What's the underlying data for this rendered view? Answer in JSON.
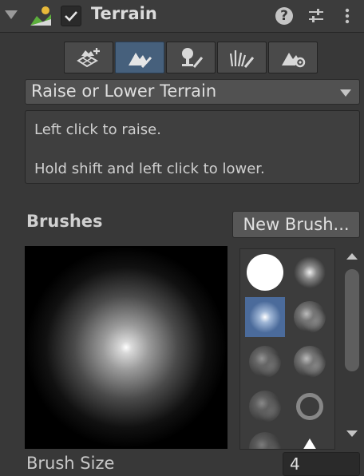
{
  "header": {
    "title": "Terrain",
    "enabled": true
  },
  "toolbar": {
    "tools": [
      {
        "icon": "create-neighbor-terrain-icon"
      },
      {
        "icon": "paint-terrain-icon",
        "active": true
      },
      {
        "icon": "paint-trees-icon"
      },
      {
        "icon": "paint-details-icon"
      },
      {
        "icon": "terrain-settings-icon"
      }
    ]
  },
  "tool_select": {
    "value": "Raise or Lower Terrain"
  },
  "help": {
    "line1": "Left click to raise.",
    "line2": "Hold shift and left click to lower."
  },
  "brushes": {
    "label": "Brushes",
    "new_button": "New Brush...",
    "selected_index": 2
  },
  "brush_size": {
    "label": "Brush Size",
    "value": "4"
  },
  "colors": {
    "background": "#383838",
    "accent": "#46607c",
    "selected_brush": "#4b6b9b"
  }
}
